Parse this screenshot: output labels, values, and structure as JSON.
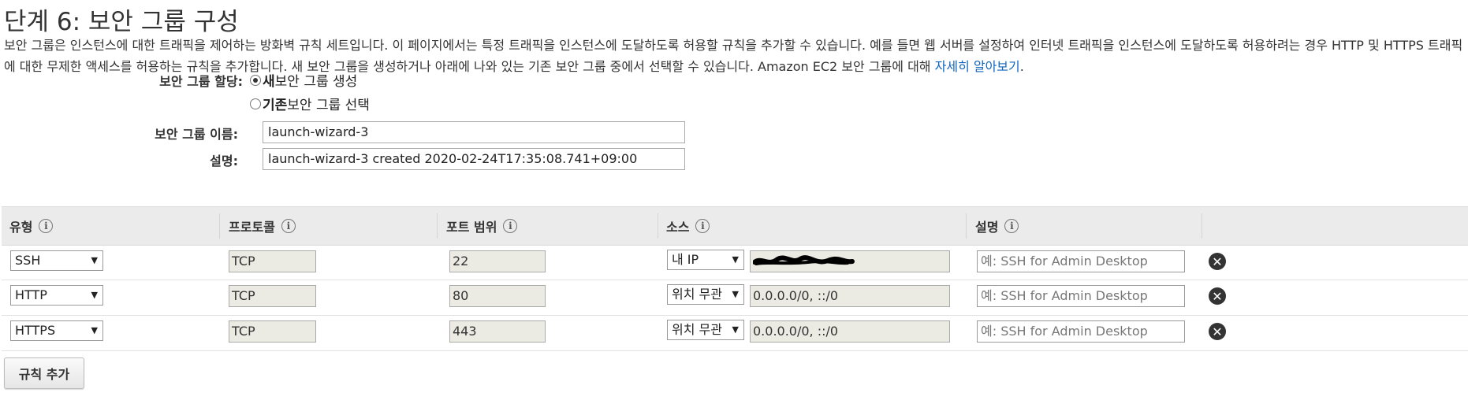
{
  "page": {
    "title": "단계 6: 보안 그룹 구성",
    "description_main": "보안 그룹은 인스턴스에 대한 트래픽을 제어하는 방화벽 규칙 세트입니다. 이 페이지에서는 특정 트래픽을 인스턴스에 도달하도록 허용할 규칙을 추가할 수 있습니다. 예를 들면 웹 서버를 설정하여 인터넷 트래픽을 인스턴스에 도달하도록 허용하려는 경우 HTTP 및 HTTPS 트래픽에 대한 무제한 액세스를 허용하는 규칙을 추가합니다. 새 보안 그룹을 생성하거나 아래에 나와 있는 기존 보안 그룹 중에서 선택할 수 있습니다. Amazon EC2 보안 그룹에 대해 ",
    "description_link": "자세히 알아보기",
    "description_end": "."
  },
  "form": {
    "assign_label": "보안 그룹 할당:",
    "option_new_bold": "새",
    "option_new_rest": " 보안 그룹 생성",
    "option_existing_bold": "기존",
    "option_existing_rest": " 보안 그룹 선택",
    "selected_option": "new",
    "name_label": "보안 그룹 이름:",
    "name_value": "launch-wizard-3",
    "desc_label": "설명:",
    "desc_value": "launch-wizard-3 created 2020-02-24T17:35:08.741+09:00"
  },
  "table": {
    "headers": [
      "유형",
      "프로토콜",
      "포트 범위",
      "소스",
      "설명"
    ],
    "info_glyph": "i",
    "rows": [
      {
        "type": "SSH",
        "protocol": "TCP",
        "port": "22",
        "source_select": "내 IP",
        "source_value": "",
        "description_placeholder": "예: SSH for Admin Desktop"
      },
      {
        "type": "HTTP",
        "protocol": "TCP",
        "port": "80",
        "source_select": "위치 무관",
        "source_value": "0.0.0.0/0, ::/0",
        "description_placeholder": "예: SSH for Admin Desktop"
      },
      {
        "type": "HTTPS",
        "protocol": "TCP",
        "port": "443",
        "source_select": "위치 무관",
        "source_value": "0.0.0.0/0, ::/0",
        "description_placeholder": "예: SSH for Admin Desktop"
      }
    ],
    "dropdown_arrow": "▼",
    "delete_glyph": "✕"
  },
  "actions": {
    "add_rule": "규칙 추가"
  }
}
